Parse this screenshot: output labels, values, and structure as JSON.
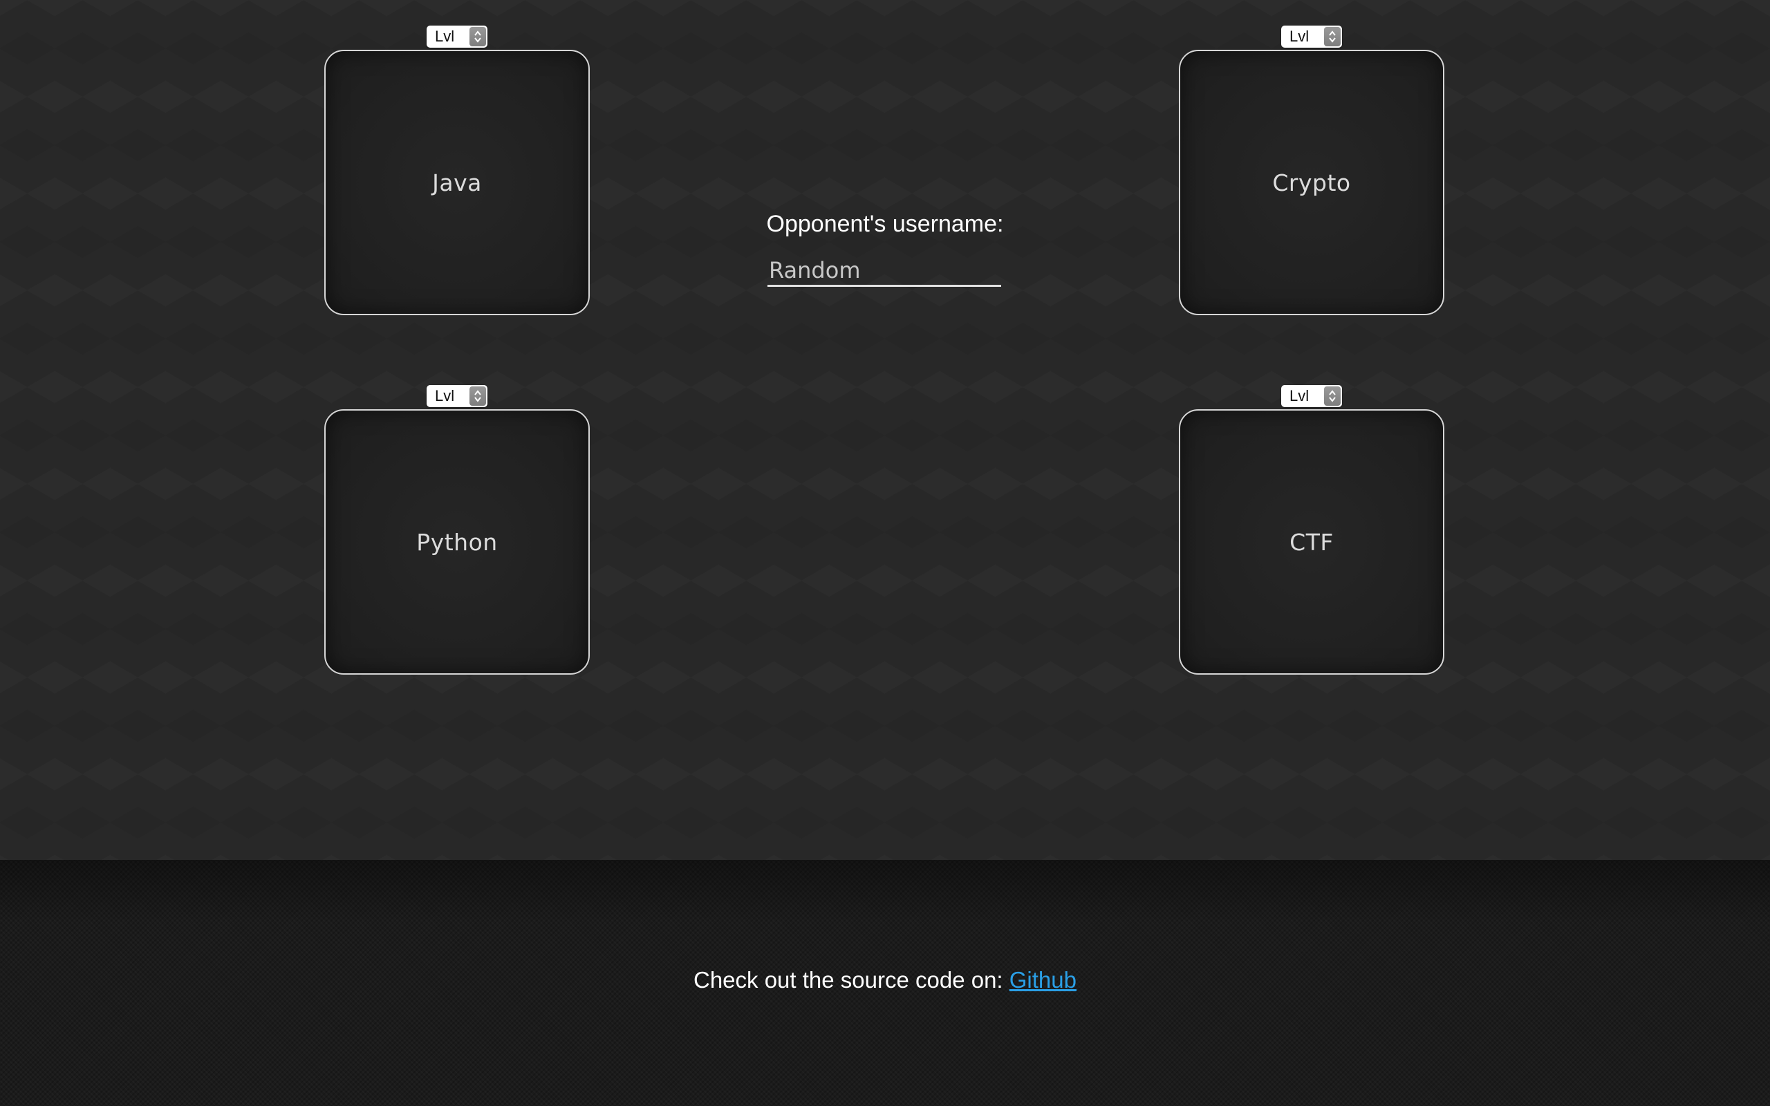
{
  "categories": [
    {
      "label": "Java",
      "level_select": "Lvl"
    },
    {
      "label": "Crypto",
      "level_select": "Lvl"
    },
    {
      "label": "Python",
      "level_select": "Lvl"
    },
    {
      "label": "CTF",
      "level_select": "Lvl"
    }
  ],
  "opponent": {
    "label": "Opponent's username:",
    "placeholder": "Random"
  },
  "footer": {
    "text": "Check out the source code on: ",
    "link_label": "Github",
    "link_color": "#2a9fe6"
  },
  "colors": {
    "background": "#282828",
    "card_border": "#d6d6d6",
    "footer_background": "#1b1b1b"
  }
}
